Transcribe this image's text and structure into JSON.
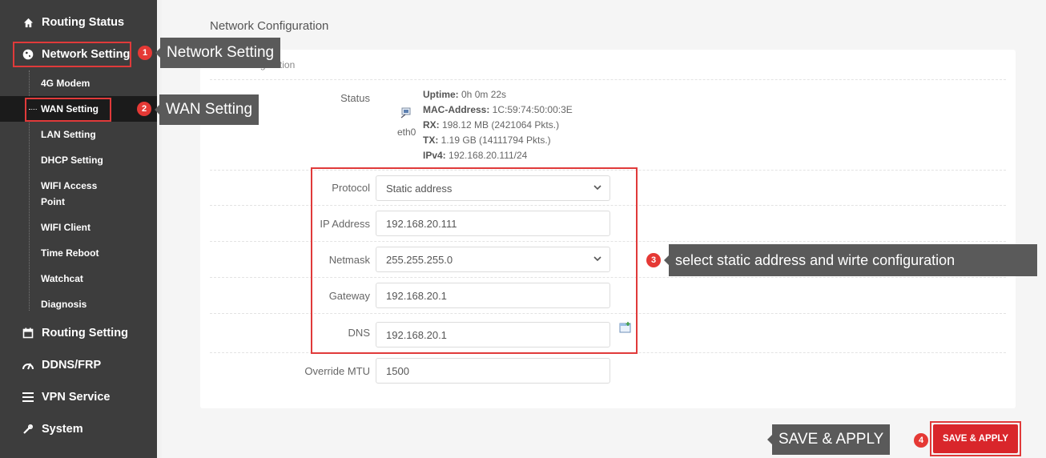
{
  "sidebar": {
    "items": [
      {
        "label": "Routing Status",
        "icon": "home-icon"
      },
      {
        "label": "Network Setting",
        "icon": "globe-icon"
      },
      {
        "label": "Routing Setting",
        "icon": "calendar-icon"
      },
      {
        "label": "DDNS/FRP",
        "icon": "gauge-icon"
      },
      {
        "label": "VPN Service",
        "icon": "list-icon"
      },
      {
        "label": "System",
        "icon": "tools-icon"
      }
    ],
    "sub_items": [
      {
        "label": "4G Modem"
      },
      {
        "label": "WAN Setting"
      },
      {
        "label": "LAN Setting"
      },
      {
        "label": "DHCP Setting"
      },
      {
        "label": "WIFI Access Point"
      },
      {
        "label": "WIFI Client"
      },
      {
        "label": "Time Reboot"
      },
      {
        "label": "Watchcat"
      },
      {
        "label": "Diagnosis"
      }
    ]
  },
  "main": {
    "title": "Network Configuration",
    "fieldset_title": "WAN Configuration",
    "status": {
      "label": "Status",
      "interface": "eth0",
      "uptime_label": "Uptime:",
      "uptime_value": " 0h 0m 22s",
      "mac_label": "MAC-Address:",
      "mac_value": " 1C:59:74:50:00:3E",
      "rx_label": "RX:",
      "rx_value": " 198.12 MB (2421064 Pkts.)",
      "tx_label": "TX:",
      "tx_value": " 1.19 GB (14111794 Pkts.)",
      "ipv4_label": "IPv4:",
      "ipv4_value": " 192.168.20.111/24"
    },
    "fields": {
      "protocol": {
        "label": "Protocol",
        "value": "Static address"
      },
      "ip": {
        "label": "IP Address",
        "value": "192.168.20.111"
      },
      "netmask": {
        "label": "Netmask",
        "value": "255.255.255.0"
      },
      "gateway": {
        "label": "Gateway",
        "value": "192.168.20.1"
      },
      "dns": {
        "label": "DNS",
        "value": "192.168.20.1"
      },
      "mtu": {
        "label": "Override MTU",
        "value": "1500"
      }
    },
    "save_button": "SAVE & APPLY"
  },
  "annotations": {
    "step1": {
      "num": "1",
      "text": "Network Setting"
    },
    "step2": {
      "num": "2",
      "text": "WAN Setting"
    },
    "step3": {
      "num": "3",
      "text": "select static address and wirte configuration"
    },
    "step4": {
      "num": "4",
      "text": "SAVE & APPLY"
    }
  },
  "colors": {
    "sidebar_bg": "#3d3d3d",
    "accent_red": "#d9262b",
    "annotation_red": "#e03a3a",
    "callout_bg": "#5a5a5a"
  }
}
